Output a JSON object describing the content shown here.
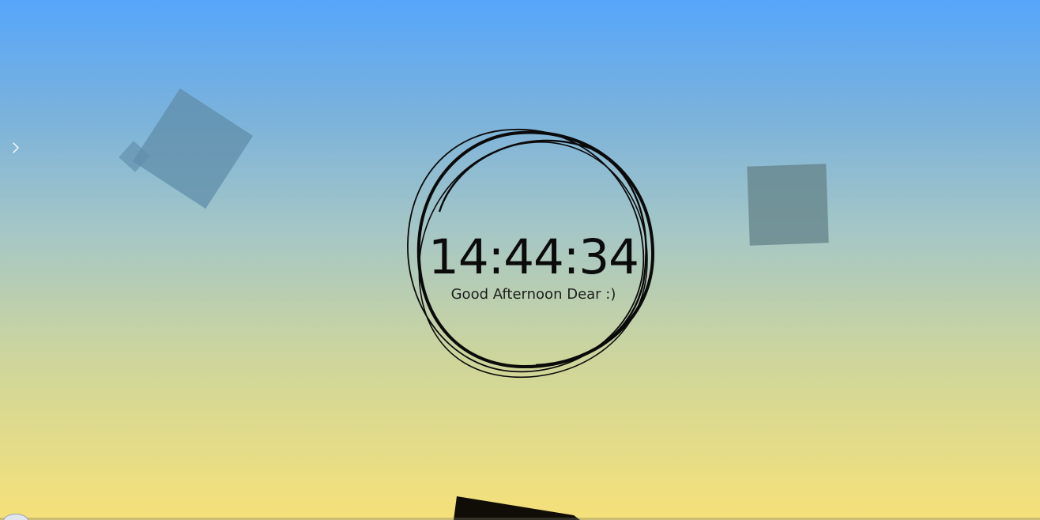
{
  "clock": {
    "time": "14:44:34",
    "greeting": "Good Afternoon Dear :)"
  },
  "sidebar": {
    "toggle_icon": "chevron-right-icon"
  },
  "colors": {
    "gradient_top": "#56a6fb",
    "gradient_bottom": "#f6e179",
    "text": "#0b0b0b",
    "shape_blue": "#608eaa",
    "shape_gray": "#66868c"
  }
}
